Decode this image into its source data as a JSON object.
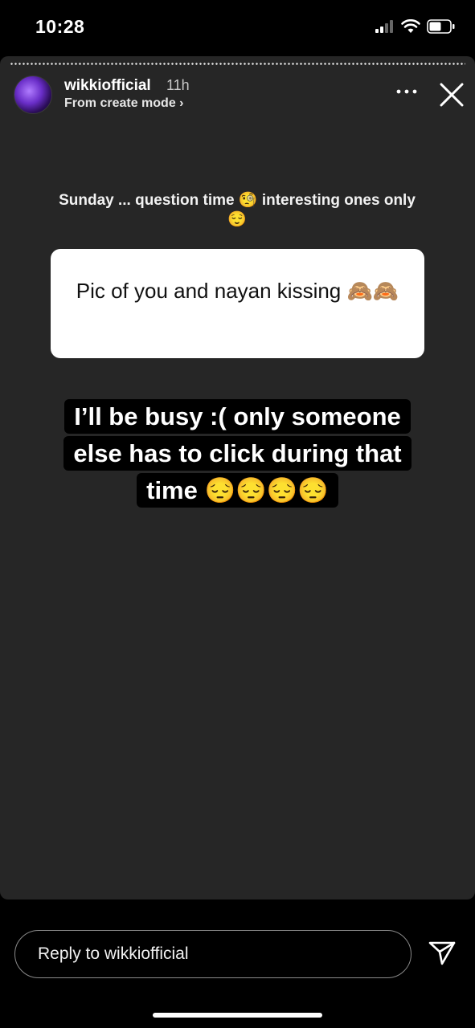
{
  "status_bar": {
    "time": "10:28",
    "icons": [
      "cellular-signal-icon",
      "wifi-icon",
      "battery-icon"
    ]
  },
  "story": {
    "username": "wikkiofficial",
    "time_ago": "11h",
    "mode": "From create mode ›",
    "question_prompt": "Sunday ... question time 🧐 interesting ones only😌",
    "question_answer": "Pic of you and nayan kissing 🙈🙈",
    "caption": "I’ll be busy :( only someone else has to click during that time 😔😔😔😔"
  },
  "reply": {
    "placeholder": "Reply to wikkiofficial"
  },
  "colors": {
    "background": "#000000",
    "story_background": "#262626",
    "card_background": "#ffffff"
  }
}
